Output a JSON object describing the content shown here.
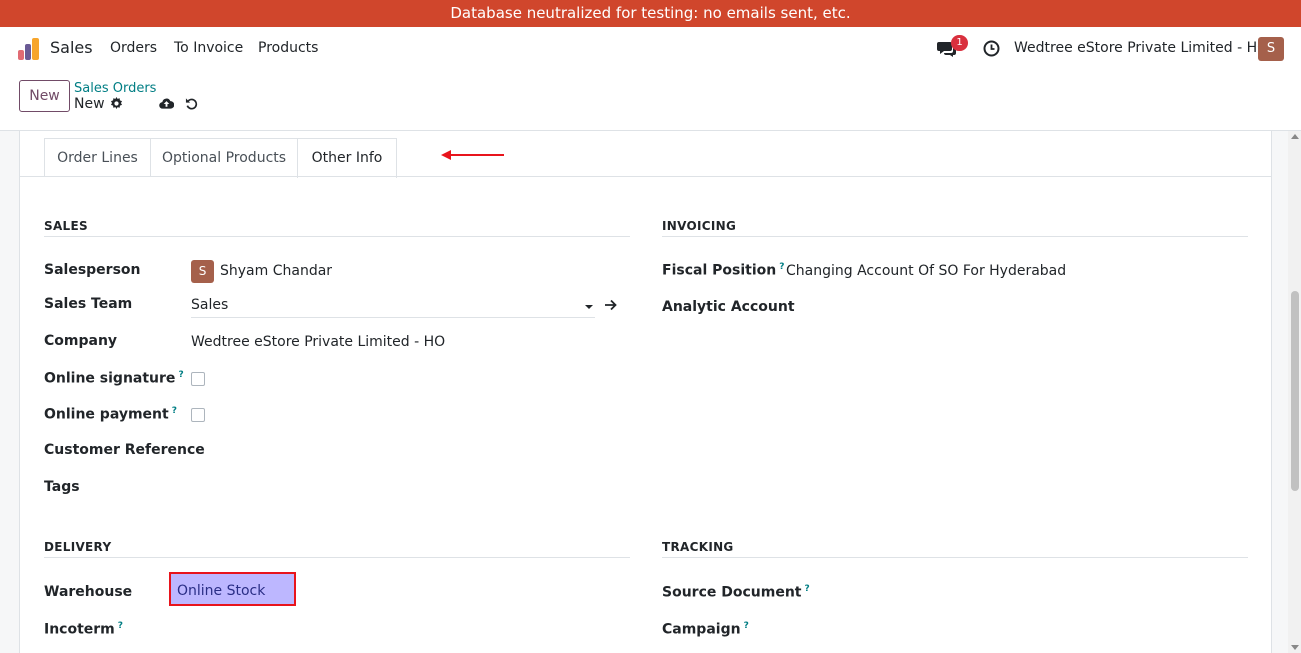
{
  "banner": {
    "text": "Database neutralized for testing: no emails sent, etc."
  },
  "navbar": {
    "app_name": "Sales",
    "items": [
      "Orders",
      "To Invoice",
      "Products"
    ],
    "chat_badge": "1",
    "company": "Wedtree eStore Private Limited - HO",
    "avatar_initial": "S"
  },
  "control": {
    "new_label": "New",
    "breadcrumb_parent": "Sales Orders",
    "breadcrumb_current": "New"
  },
  "tabs": [
    "Order Lines",
    "Optional Products",
    "Other Info"
  ],
  "active_tab": "Other Info",
  "sales": {
    "title": "SALES",
    "salesperson_label": "Salesperson",
    "salesperson_initial": "S",
    "salesperson_value": "Shyam Chandar",
    "team_label": "Sales Team",
    "team_value": "Sales",
    "company_label": "Company",
    "company_value": "Wedtree eStore Private Limited - HO",
    "online_signature_label": "Online signature",
    "online_payment_label": "Online payment",
    "customer_reference_label": "Customer Reference",
    "tags_label": "Tags",
    "help_mark": "?"
  },
  "invoicing": {
    "title": "INVOICING",
    "fiscal_position_label": "Fiscal Position",
    "fiscal_position_value": "Changing Account Of SO For Hyderabad",
    "analytic_account_label": "Analytic Account"
  },
  "delivery": {
    "title": "DELIVERY",
    "warehouse_label": "Warehouse",
    "warehouse_value": "Online Stock",
    "incoterm_label": "Incoterm"
  },
  "tracking": {
    "title": "TRACKING",
    "source_document_label": "Source Document",
    "campaign_label": "Campaign"
  },
  "colors": {
    "banner": "#d0462c",
    "brand": "#714b67",
    "link": "#017e84",
    "avatar": "#a5604b",
    "highlight_fill": "#bdb7ff",
    "highlight_border": "#e8141c"
  },
  "icons": [
    "sales-logo-icon",
    "chat-icon",
    "clock-icon",
    "gear-icon",
    "cloud-upload-icon",
    "undo-icon",
    "dropdown-caret-icon",
    "arrow-right-icon",
    "annotation-arrow-icon"
  ]
}
